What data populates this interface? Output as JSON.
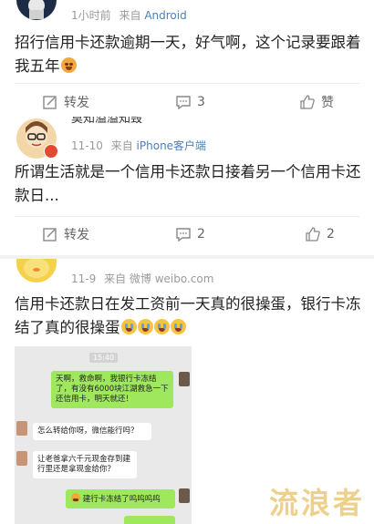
{
  "posts": [
    {
      "time": "1小时前",
      "via": "来自",
      "source": "Android",
      "text": "招行信用卡还款逾期一天，好气啊，这个记录要跟着我五年",
      "actions": {
        "repost": "转发",
        "comment": "3",
        "like": "赞"
      }
    },
    {
      "user": "莫知溢溢知毁",
      "time": "11-10",
      "via": "来自",
      "source": "iPhone客户端",
      "text": "所谓生活就是一个信用卡还款日接着另一个信用卡还款日...",
      "actions": {
        "repost": "转发",
        "comment": "2",
        "like": "2"
      }
    },
    {
      "time": "11-9",
      "via": "来自",
      "source": "微博 weibo.com",
      "text": "信用卡还款日在发工资前一天真的很操蛋，银行卡冻结了真的很操蛋"
    }
  ],
  "chat": {
    "timestamp": "15:40",
    "msg1": "天啊，救命啊，我银行卡冻结了，有没有6000块江湖救急一下还信用卡，明天就还！",
    "msg2": "怎么转给你呀，微信能行吗？",
    "msg3": "让老爸拿六千元现金存到建行里还是拿现金给你？",
    "msg4": "建行卡冻结了呜呜呜呜"
  },
  "watermark": "流浪者",
  "colors": {
    "link": "#4a7fb8",
    "chat_green": "#9fe85e",
    "watermark": "#e9c56e"
  }
}
